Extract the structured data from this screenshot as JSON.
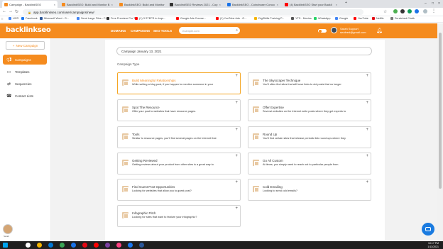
{
  "browser": {
    "tabs": [
      {
        "label": "Campaign - BacklinkSEO",
        "active": true,
        "color": "#f58b1e"
      },
      {
        "label": "BacklinkSEO: Build and Monitor B",
        "color": "#f58b1e"
      },
      {
        "label": "BacklinkSEO: Build and Monitor B",
        "color": "#f58b1e"
      },
      {
        "label": "BacklinkSEO Reviews 2021 - Cop",
        "color": "#333333"
      },
      {
        "label": "BacklinkSEO - Coinchaser Conco",
        "color": "#1a73e8"
      },
      {
        "label": "(4) BacklinkSEO Start your Backli",
        "color": "#ff0000"
      }
    ],
    "url": "app.backlinkseo.com/user/campaigns/new/",
    "bookmarks": [
      {
        "label": "UCR",
        "color": "#4285f4"
      },
      {
        "label": "Facebook",
        "color": "#1877f2"
      },
      {
        "label": "Microsoft Word - G...",
        "color": "#2b579a"
      },
      {
        "label": "Send Large Files - F...",
        "color": "#4285f4"
      },
      {
        "label": "Free Premiere Pro T...",
        "color": "#333333"
      },
      {
        "label": "(1) 3 STEPS to Impr...",
        "color": "#ff0000"
      },
      {
        "label": "Google Ads Course...",
        "color": "#ff0000"
      },
      {
        "label": "(1) YouTube Ads - G...",
        "color": "#ff0000"
      },
      {
        "label": "DigiSkills Training P...",
        "color": "#f4b400"
      },
      {
        "label": "YTS - Movies",
        "color": "#555555"
      },
      {
        "label": "WhatsApp",
        "color": "#25d366"
      },
      {
        "label": "Google",
        "color": "#4285f4"
      },
      {
        "label": "YouTube",
        "color": "#ff0000"
      },
      {
        "label": "Netflix",
        "color": "#e50914"
      },
      {
        "label": "Scratched Chalk",
        "color": "#777777"
      }
    ]
  },
  "app": {
    "logo_text": "backlink",
    "logo_text2": "seo",
    "nav": [
      "DOMAINS",
      "CAMPAIGNS",
      "SEO TOOLS"
    ],
    "search_placeholder": "example.com",
    "user_name": "Sarah Support",
    "user_email": "seofeed@gmail.com",
    "accent_color": "#f58b1e"
  },
  "sidebar": {
    "new_campaign_label": "New Campaign",
    "items": [
      {
        "label": "Campaigns",
        "icon": "megaphone-icon",
        "active": true
      },
      {
        "label": "Templates",
        "icon": "template-icon",
        "active": false
      },
      {
        "label": "Sequencies",
        "icon": "sequence-icon",
        "active": false
      },
      {
        "label": "Contact Lists",
        "icon": "phone-icon",
        "active": false
      }
    ],
    "avatar_label": "Sarah"
  },
  "main": {
    "campaign_name": "Campaign January 13, 2021",
    "campaign_type_label": "Campaign Type",
    "cards": [
      {
        "title": "Build Meaningful Relationships",
        "desc": "While writing a blog post, if you happen to mention someone in your",
        "selected": true
      },
      {
        "title": "The Skyscraper Technique",
        "desc": "You'll often find sites that will have links to old posts that no longer",
        "selected": false
      },
      {
        "title": "Spot The Resource",
        "desc": "Offer your post to websites that have resource pages.",
        "selected": false
      },
      {
        "title": "Offer Expertise",
        "desc": "Several websites on the Internet write posts where they get experts to",
        "selected": false
      },
      {
        "title": "Tools",
        "desc": "Similar to resource pages, you'll find several pages on the Internet that",
        "selected": false
      },
      {
        "title": "Round Up",
        "desc": "You'll find certain sites that release periodic link round ups where they",
        "selected": false
      },
      {
        "title": "Getting Reviewed",
        "desc": "Getting reviews about your product from other sites is a great way to",
        "selected": false
      },
      {
        "title": "Go All Custom",
        "desc": "At times, you simply need to reach out to particular people from",
        "selected": false
      },
      {
        "title": "Find Guest Post Opportunities",
        "desc": "Looking for websites that allow you to guest post?",
        "selected": false
      },
      {
        "title": "Cold Emailing",
        "desc": "Looking to send cold emails?",
        "selected": false
      },
      {
        "title": "Infographic Pitch",
        "desc": "Looking for sites that want to feature your infographic?",
        "selected": false
      }
    ]
  },
  "taskbar": {
    "time": "10:17 PM",
    "date": "1/13/2021",
    "apps": [
      "#00a4ef",
      "#ffffff",
      "#f4b400",
      "#0078d7",
      "#3aa757",
      "#1a73e8",
      "#e50914",
      "#ff0000",
      "#7b3fa0",
      "#ff4081",
      "#1877f2",
      "#2b579a"
    ]
  }
}
